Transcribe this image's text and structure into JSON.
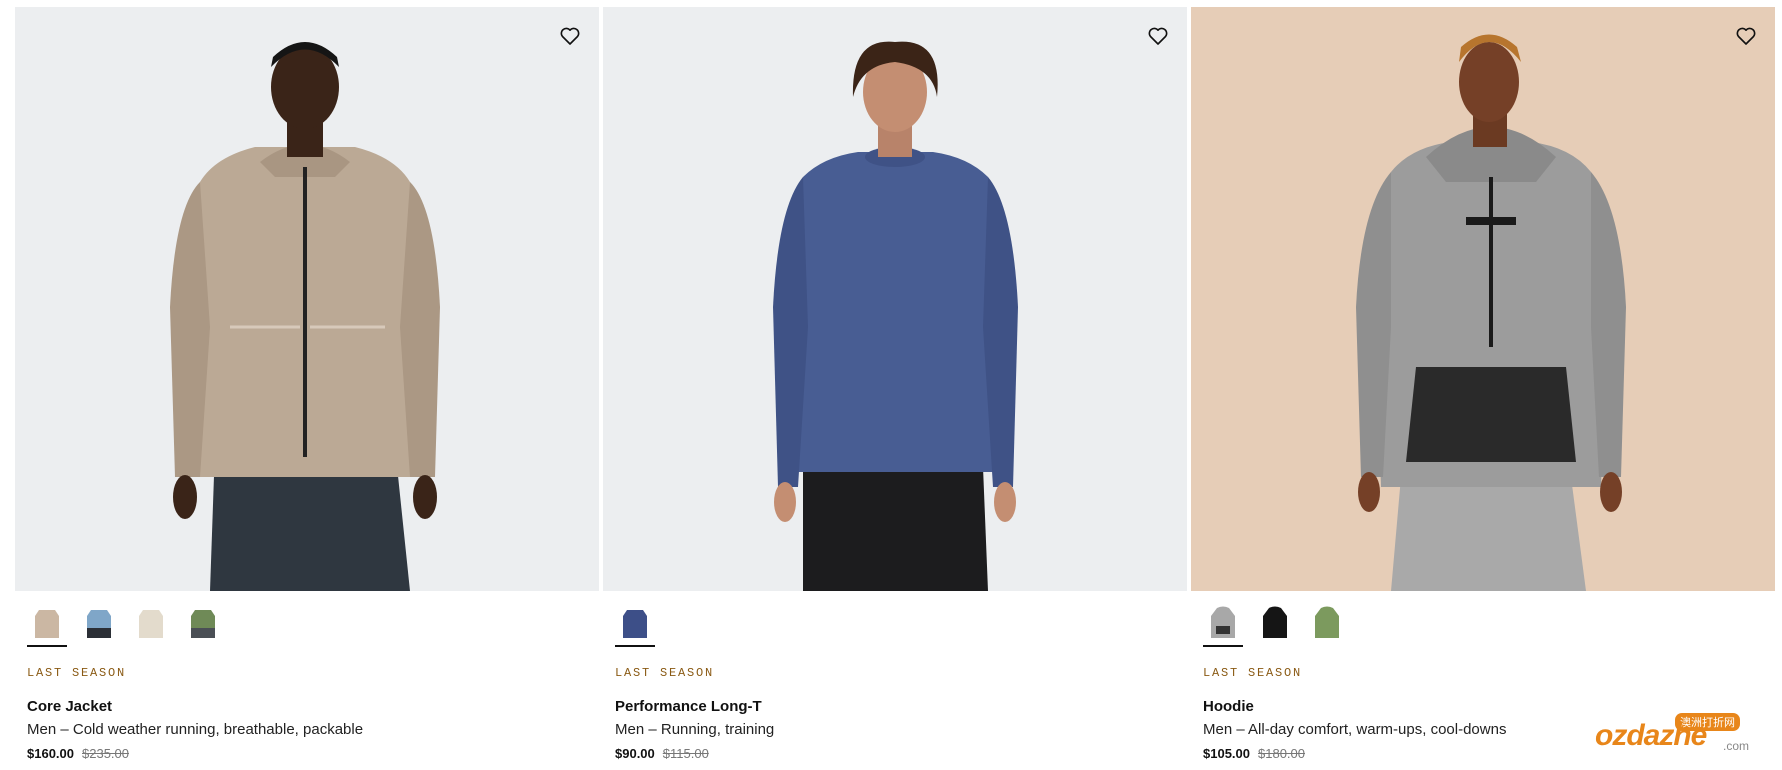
{
  "products": [
    {
      "tag": "LAST SEASON",
      "name": "Core Jacket",
      "description": "Men – Cold weather running, breathable, packable",
      "price": "$160.00",
      "original_price": "$235.00",
      "background": "#eceef0",
      "swatch_colors": [
        "#cbb7a3",
        "#7fa6c8",
        "#e3dbcc",
        "#6f8a57"
      ],
      "wishlist_icon": "heart-outline-icon"
    },
    {
      "tag": "LAST SEASON",
      "name": "Performance Long-T",
      "description": "Men – Running, training",
      "price": "$90.00",
      "original_price": "$115.00",
      "background": "#eceef0",
      "swatch_colors": [
        "#3d4f88"
      ],
      "wishlist_icon": "heart-outline-icon"
    },
    {
      "tag": "LAST SEASON",
      "name": "Hoodie",
      "description": "Men – All-day comfort, warm-ups, cool-downs",
      "price": "$105.00",
      "original_price": "$180.00",
      "background": "#e6cdb7",
      "swatch_colors": [
        "#a8a8a8",
        "#151515",
        "#7c9a5e"
      ],
      "wishlist_icon": "heart-outline-icon"
    }
  ],
  "watermark": {
    "logo_text": "ozdazhe",
    "domain": ".com",
    "badge": "澳洲打折网"
  }
}
